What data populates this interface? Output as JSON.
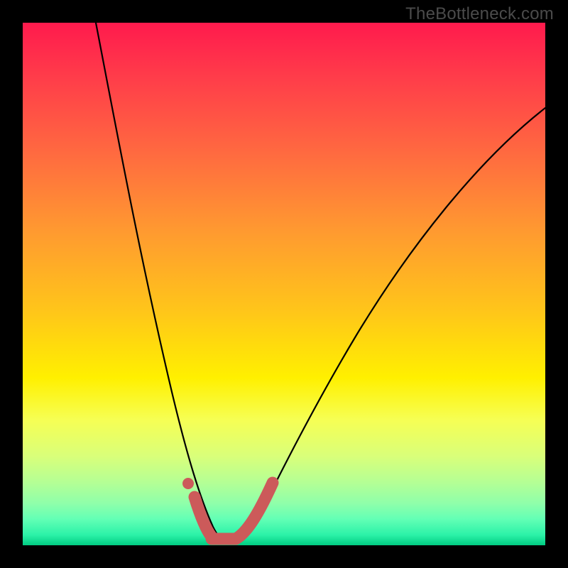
{
  "watermark": "TheBottleneck.com",
  "chart_data": {
    "type": "line",
    "title": "",
    "xlabel": "",
    "ylabel": "",
    "xlim": [
      0,
      100
    ],
    "ylim": [
      0,
      100
    ],
    "grid": false,
    "legend": false,
    "series": [
      {
        "name": "curve",
        "x": [
          14,
          16,
          18,
          20,
          22,
          24,
          26,
          28,
          30,
          32,
          34,
          36,
          38,
          40,
          45,
          50,
          55,
          60,
          65,
          70,
          75,
          80,
          85,
          90,
          95,
          100
        ],
        "y": [
          100,
          87,
          75,
          64,
          54,
          45,
          37,
          29,
          22,
          15,
          9,
          5,
          2,
          0,
          7,
          14,
          21,
          28,
          34,
          40,
          45,
          50,
          54,
          58,
          62,
          65
        ],
        "stroke": "#000000",
        "width": 2
      },
      {
        "name": "highlight",
        "x": [
          30,
          32,
          34,
          36,
          38,
          40
        ],
        "y": [
          22,
          5,
          1,
          0,
          1,
          7
        ],
        "stroke": "#cc5a5a",
        "width": 14
      }
    ],
    "annotations": [
      {
        "name": "highlight-dot",
        "x": 30,
        "y": 12
      }
    ]
  }
}
